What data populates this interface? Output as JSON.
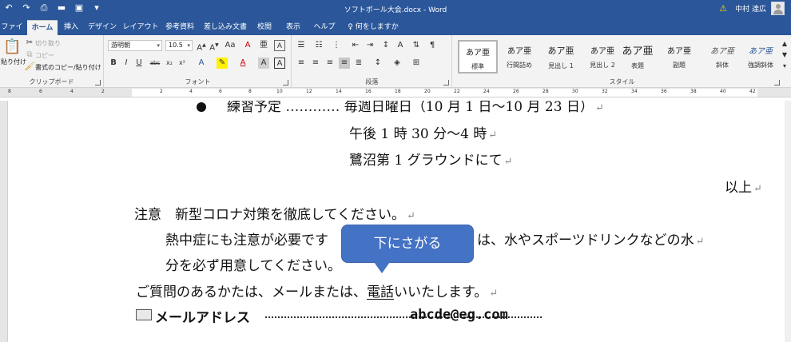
{
  "titlebar": {
    "title": "ソフトボール大会.docx  -  Word",
    "user_name": "中村 達広",
    "qat": [
      "undo-icon",
      "redo-icon",
      "print-preview-icon",
      "open-folder-icon",
      "save-icon",
      "customize-icon"
    ]
  },
  "tabs": [
    {
      "label": "ファイル"
    },
    {
      "label": "ホーム"
    },
    {
      "label": "挿入"
    },
    {
      "label": "デザイン"
    },
    {
      "label": "レイアウト"
    },
    {
      "label": "参考資料"
    },
    {
      "label": "差し込み文書"
    },
    {
      "label": "校閲"
    },
    {
      "label": "表示"
    },
    {
      "label": "ヘルプ"
    },
    {
      "label": "何をしますか"
    }
  ],
  "ribbon": {
    "clipboard": {
      "paste_label": "貼り付け",
      "cut_label": "切り取り",
      "copy_label": "コピー",
      "format_painter_label": "書式のコピー/貼り付け",
      "group_label": "クリップボード"
    },
    "font": {
      "font_name": "游明朝",
      "font_size": "10.5",
      "group_label": "フォント"
    },
    "paragraph": {
      "group_label": "段落"
    },
    "styles": {
      "group_label": "スタイル",
      "tiles": [
        {
          "preview": "あア亜",
          "name": "標準"
        },
        {
          "preview": "あア亜",
          "name": "行間詰め"
        },
        {
          "preview": "あア亜",
          "name": "見出し 1"
        },
        {
          "preview": "あア亜",
          "name": "見出し 2"
        },
        {
          "preview": "あア亜",
          "name": "表題"
        },
        {
          "preview": "あア亜",
          "name": "副題"
        },
        {
          "preview": "あア亜",
          "name": "斜体"
        },
        {
          "preview": "あア亜",
          "name": "強調斜体"
        }
      ]
    }
  },
  "ruler": {
    "left_numbers": [
      "8",
      "6",
      "4",
      "2"
    ],
    "numbers": [
      "2",
      "4",
      "6",
      "8",
      "10",
      "12",
      "14",
      "16",
      "18",
      "20",
      "22",
      "24",
      "26",
      "28",
      "30",
      "32",
      "34",
      "36",
      "38",
      "40",
      "42"
    ]
  },
  "document": {
    "line1": "練習予定 ………… 毎週日曜日（10 月 1 日〜10 月 23 日）",
    "line2": "午後 1 時 30 分〜4 時",
    "line3": "鷺沼第 1 グラウンドにて",
    "closing": "以上",
    "note_heading": "注意　新型コロナ対策を徹底してください。",
    "note_line2_a": "熱中症にも注意が必要です",
    "note_line2_b": "は、水やスポーツドリンクなどの水",
    "note_line3": "分を必ず用意してください。",
    "question_a": "ご質問のあるかたは、メールまたは、",
    "question_denwa": "電話",
    "question_b": "いいたします。",
    "mail_label": "メールアドレス",
    "mail_address": "abcde@eg.com"
  },
  "callout": {
    "text": "下にさがる"
  }
}
